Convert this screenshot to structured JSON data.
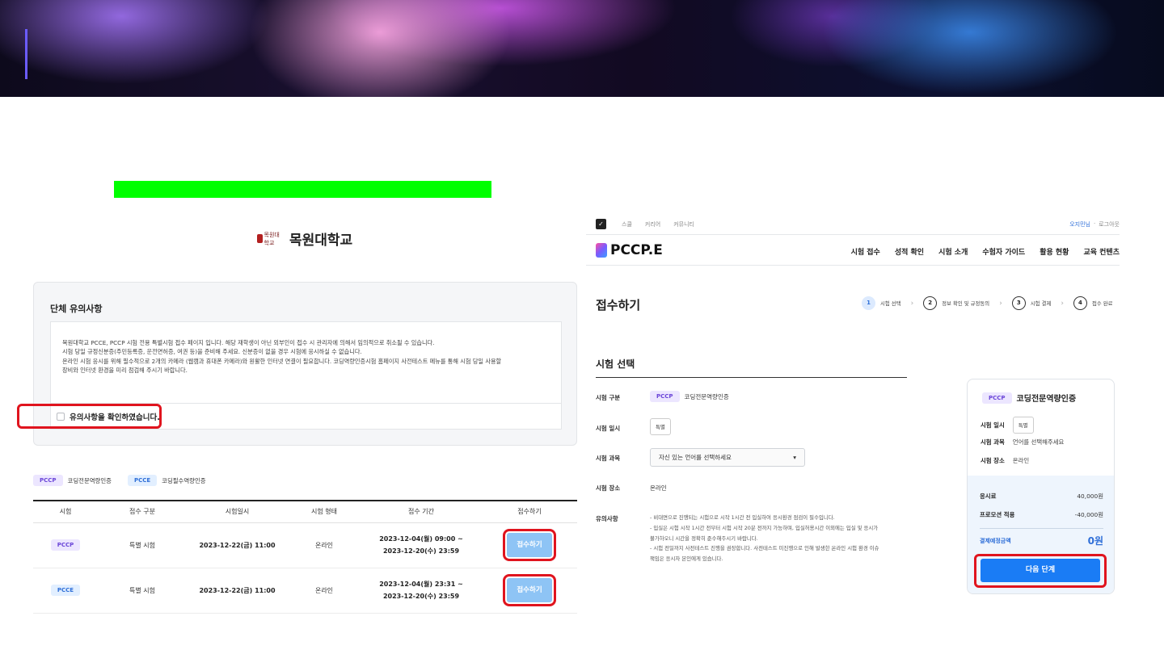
{
  "left": {
    "university_name": "목원대학교",
    "logo_text": "목원대학교",
    "notice": {
      "title": "단체 유의사항",
      "lines": [
        "목원대학교 PCCE, PCCP 시험 전용 특별시험 접수 페이지 입니다. 해당 재학생이 아닌 외부인이 접수 시 관리자에 의해서 임의적으로 취소될 수 있습니다.",
        "시험 당일 규정신분증(주민등록증, 운전면허증, 여권 등)을 준비해 주세요. 신분증이 없을 경우 시험에 응시하실 수 없습니다.",
        "온라인 시험 응시를 위해 필수적으로 2개의 카메라 (웹캠과 휴대폰 카메라)와 원활한 인터넷 연결이 필요합니다. 코딩역량인증시험 홈페이지 사전테스트 메뉴를 통해 시험 당일 사용할",
        "장비와 인터넷 환경을 미리 점검해 주시기 바랍니다."
      ],
      "confirm_label": "유의사항을 확인하였습니다."
    },
    "legend": [
      {
        "tag": "PCCP",
        "label": "코딩전문역량인증"
      },
      {
        "tag": "PCCE",
        "label": "코딩필수역량인증"
      }
    ],
    "table": {
      "headers": [
        "시험",
        "접수 구분",
        "시험일시",
        "시험 형태",
        "접수 기간",
        "접수하기"
      ],
      "rows": [
        {
          "exam": "PCCP",
          "type": "특별 시험",
          "date": "2023-12-22(금) 11:00",
          "mode": "온라인",
          "period_start": "2023-12-04(월) 09:00 ~",
          "period_end": "2023-12-20(수) 23:59",
          "button": "접수하기"
        },
        {
          "exam": "PCCE",
          "type": "특별 시험",
          "date": "2023-12-22(금) 11:00",
          "mode": "온라인",
          "period_start": "2023-12-04(월) 23:31 ~",
          "period_end": "2023-12-20(수) 23:59",
          "button": "접수하기"
        }
      ]
    }
  },
  "right": {
    "topnav": {
      "links": [
        "스쿨",
        "커리어",
        "커뮤니티"
      ],
      "user_name": "오지민님",
      "separator": "·",
      "logout": "로그아웃"
    },
    "logo": "PCCP.E",
    "menu": [
      "시험 접수",
      "성적 확인",
      "시험 소개",
      "수험자 가이드",
      "활용 현황",
      "교육 컨텐츠"
    ],
    "page_title": "접수하기",
    "steps": [
      {
        "num": "1",
        "label": "시험 선택"
      },
      {
        "num": "2",
        "label": "정보 확인 및 규정동의"
      },
      {
        "num": "3",
        "label": "시험 결제"
      },
      {
        "num": "4",
        "label": "접수 완료"
      }
    ],
    "section_title": "시험 선택",
    "form": {
      "category_label": "시험 구분",
      "category_tag": "PCCP",
      "category_value": "코딩전문역량인증",
      "date_label": "시험 일시",
      "date_value": "특별",
      "subject_label": "시험 과목",
      "subject_placeholder": "자신 있는 언어를 선택하세요",
      "place_label": "시험 장소",
      "place_value": "온라인",
      "notes_label": "유의사항",
      "notes": [
        "- 비대면으로 진행되는 시험으로 시작 1시간 전 입실하여 응시환경 점검이 필수입니다.",
        "- 입실은 시험 시작 1시간 전부터 시험 시작 20분 전까지 가능하며, 입실허용시간 이외에는 입실 및 응시가",
        "  불가하오니 시간을 정확히 준수해주시기 바랍니다.",
        "- 시험 전일까지 사전테스트 진행을 권장합니다. 사전테스트 미진행으로 인해 발생한 온라인 시험 환경 이슈",
        "  책임은 응시자 본인에게 있습니다."
      ]
    },
    "summary": {
      "tag": "PCCP",
      "title": "코딩전문역량인증",
      "date_label": "시험 일시",
      "date_value": "특별",
      "subject_label": "시험 과목",
      "subject_value": "언어를 선택해주세요",
      "place_label": "시험 장소",
      "place_value": "온라인",
      "fee_label": "응시료",
      "fee_value": "40,000원",
      "promo_label": "프로모션 적용",
      "promo_value": "-40,000원",
      "total_label": "결제예정금액",
      "total_value": "0원",
      "next_button": "다음 단계"
    }
  },
  "colors": {
    "highlight_red": "#e0141e",
    "primary_blue": "#1a7cf5",
    "green_bar": "#00ff00"
  }
}
